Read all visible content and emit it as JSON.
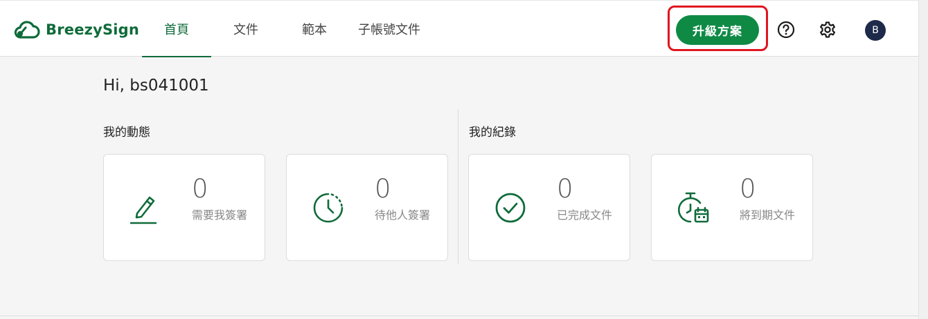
{
  "brand": {
    "name": "BreezySign",
    "color": "#0f6b3a"
  },
  "nav": {
    "items": [
      {
        "label": "首頁",
        "active": true
      },
      {
        "label": "文件",
        "active": false
      },
      {
        "label": "範本",
        "active": false
      },
      {
        "label": "子帳號文件",
        "active": false
      }
    ]
  },
  "header": {
    "upgrade_label": "升級方案",
    "help_icon": "help-circle-icon",
    "settings_icon": "gear-icon",
    "avatar_initial": "B"
  },
  "main": {
    "greeting": "Hi, bs041001",
    "sections": [
      {
        "title": "我的動態"
      },
      {
        "title": "我的紀錄"
      }
    ],
    "cards": [
      {
        "icon": "pen-sign-icon",
        "count": "0",
        "label": "需要我簽署"
      },
      {
        "icon": "clock-pending-icon",
        "count": "0",
        "label": "待他人簽署"
      },
      {
        "icon": "check-circle-icon",
        "count": "0",
        "label": "已完成文件"
      },
      {
        "icon": "stopwatch-calendar-icon",
        "count": "0",
        "label": "將到期文件"
      }
    ]
  },
  "colors": {
    "accent": "#0f8a45",
    "highlight_outline": "#e0141e"
  }
}
